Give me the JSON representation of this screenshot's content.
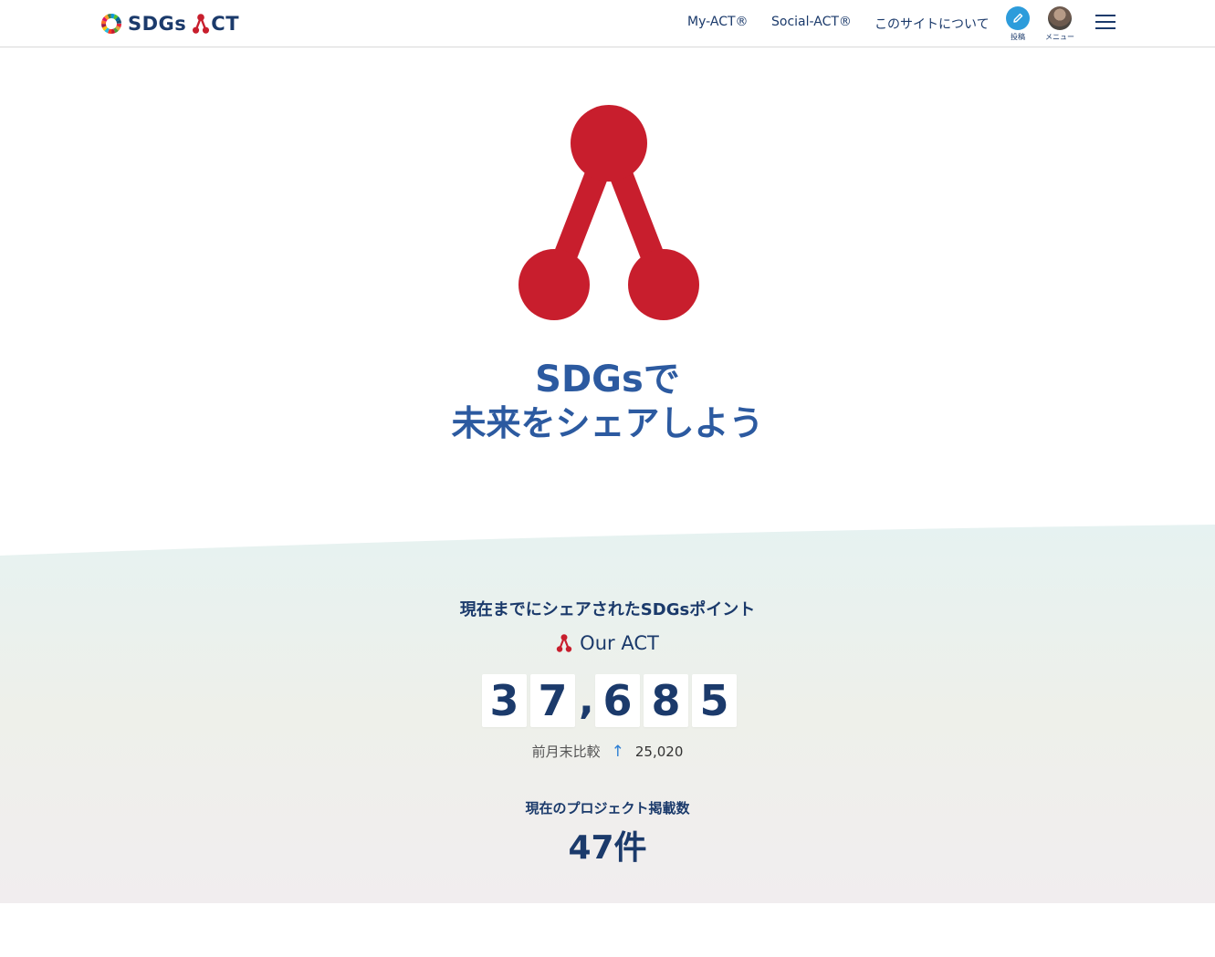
{
  "header": {
    "logo_text": "SDGs",
    "logo_text_act": "CT",
    "nav": {
      "my_act": "My-ACT®",
      "social_act": "Social-ACT®",
      "about": "このサイトについて"
    },
    "post_label": "投稿",
    "menu_label": "メニュー"
  },
  "hero": {
    "line1": "SDGsで",
    "line2": "未来をシェアしよう"
  },
  "stats": {
    "heading": "現在までにシェアされたSDGsポイント",
    "our_act": "Our ACT",
    "digits": [
      "3",
      "7",
      "6",
      "8",
      "5"
    ],
    "separator": ",",
    "compare_label": "前月末比較",
    "compare_arrow": "↑",
    "compare_value": "25,020",
    "project_heading": "現在のプロジェクト掲載数",
    "project_count": "47件"
  },
  "colors": {
    "brand_red": "#c81e2d",
    "navy": "#1b3a6b",
    "hero_blue": "#2c5aa0",
    "post_blue": "#2d9cdb"
  },
  "icons": {
    "post": "pencil-icon",
    "menu": "hamburger-icon",
    "brand_mark": "act-mark-icon"
  }
}
